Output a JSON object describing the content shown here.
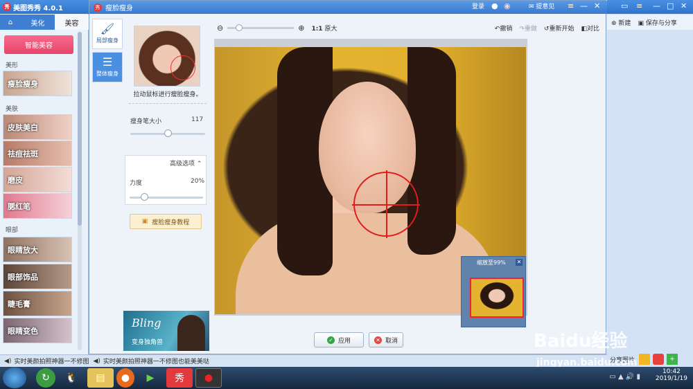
{
  "app": {
    "title": "美图秀秀 4.0.1",
    "logo": "秀",
    "tabs": [
      "美化",
      "美容"
    ],
    "smart_button": "智能美容",
    "categories": {
      "shape": "美形",
      "skin": "美肤",
      "eyes": "眼部"
    },
    "features": [
      "瘦脸瘦身",
      "皮肤美白",
      "祛痘祛斑",
      "磨皮",
      "腮红笔",
      "眼睛放大",
      "眼部饰品",
      "睫毛膏",
      "眼睛变色"
    ]
  },
  "dialog": {
    "title": "瘦脸瘦身",
    "nav": [
      "局部瘦身",
      "整体瘦身"
    ],
    "hint": "拉动鼠标进行瘦脸瘦身。",
    "brush_size_label": "瘦身笔大小",
    "brush_size_value": "117",
    "brush_size_fraction": 0.5,
    "advanced_label": "高级选项",
    "strength_label": "力度",
    "strength_value": "20%",
    "strength_fraction": 0.2,
    "tutorial_button": "瘦脸瘦身教程",
    "ad_text": "Bling",
    "ad_sub": "变身独角兽",
    "zoom_ratio": "1:1",
    "zoom_original": "原大",
    "undo": "撤销",
    "redo": "重做",
    "restart": "重新开始",
    "compare": "对比",
    "preview_title": "缩放至99%",
    "apply_button": "应用",
    "cancel_button": "取消"
  },
  "window_top": {
    "login": "登录",
    "feedback": "提意见"
  },
  "right": {
    "new_button": "新建",
    "save_share_button": "保存与分享",
    "share_image": "分享图片"
  },
  "marquee": {
    "text1": "实时美颜拍照神器一不修图",
    "text2": "实时美颜拍照神器一不修图也能美美哒"
  },
  "taskbar": {
    "time": "10:42",
    "date": "2019/1/19"
  },
  "watermark": {
    "brand": "Baidu经验",
    "url": "jingyan.baidu.com"
  }
}
